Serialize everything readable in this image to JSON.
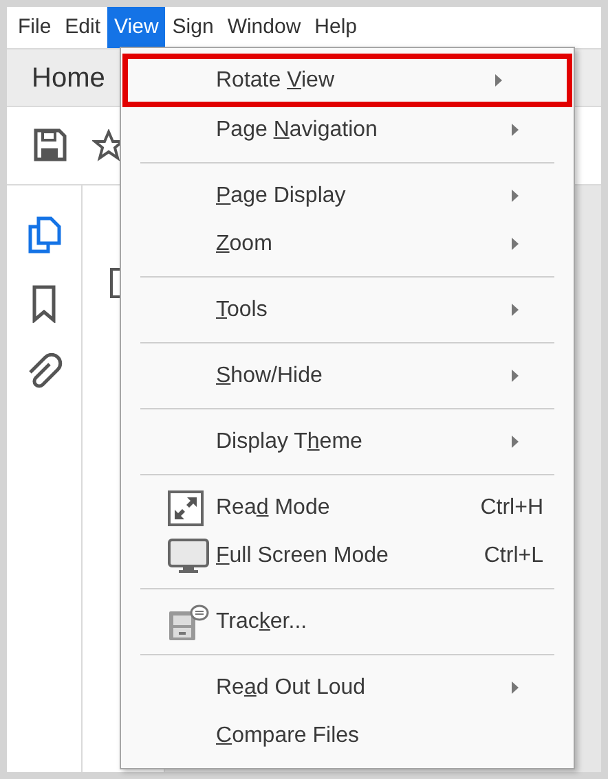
{
  "menu_bar": [
    {
      "label": "File",
      "selected": false
    },
    {
      "label": "Edit",
      "selected": false
    },
    {
      "label": "View",
      "selected": true
    },
    {
      "label": "Sign",
      "selected": false
    },
    {
      "label": "Window",
      "selected": false
    },
    {
      "label": "Help",
      "selected": false
    }
  ],
  "tabs": [
    {
      "label": "Home"
    }
  ],
  "view_menu": {
    "items": [
      {
        "kind": "submenu",
        "selected": true,
        "label": {
          "before": "Rotate ",
          "key": "V",
          "after": "iew"
        }
      },
      {
        "kind": "submenu",
        "selected": false,
        "label": {
          "before": "Page ",
          "key": "N",
          "after": "avigation"
        }
      },
      {
        "kind": "separator"
      },
      {
        "kind": "submenu",
        "selected": false,
        "label": {
          "key": "P",
          "after": "age Display"
        }
      },
      {
        "kind": "submenu",
        "selected": false,
        "label": {
          "key": "Z",
          "after": "oom"
        }
      },
      {
        "kind": "separator"
      },
      {
        "kind": "submenu",
        "selected": false,
        "label": {
          "key": "T",
          "after": "ools"
        }
      },
      {
        "kind": "separator"
      },
      {
        "kind": "submenu",
        "selected": false,
        "label": {
          "key": "S",
          "after": "how/Hide"
        }
      },
      {
        "kind": "separator"
      },
      {
        "kind": "submenu",
        "selected": false,
        "label": {
          "before": "Display T",
          "key": "h",
          "after": "eme"
        }
      },
      {
        "kind": "separator"
      },
      {
        "kind": "icon_command",
        "selected": false,
        "label": {
          "before": "Rea",
          "key": "d",
          "after": " Mode"
        },
        "shortcut": "Ctrl+H"
      },
      {
        "kind": "icon_command",
        "selected": false,
        "label": {
          "key": "F",
          "after": "ull Screen Mode"
        },
        "shortcut": "Ctrl+L"
      },
      {
        "kind": "separator"
      },
      {
        "kind": "icon_command",
        "selected": false,
        "label": {
          "before": "Trac",
          "key": "k",
          "after": "er..."
        }
      },
      {
        "kind": "separator"
      },
      {
        "kind": "submenu",
        "selected": false,
        "label": {
          "before": "Re",
          "key": "a",
          "after": "d Out Loud"
        }
      },
      {
        "kind": "command",
        "selected": false,
        "label": {
          "key": "C",
          "after": "ompare Files"
        }
      }
    ]
  }
}
